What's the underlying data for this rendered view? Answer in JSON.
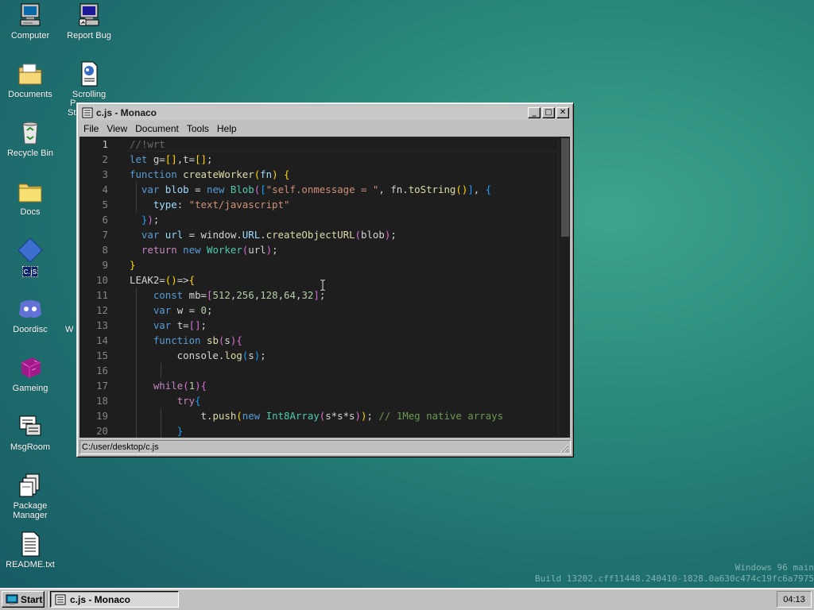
{
  "desktop": {
    "icons": [
      {
        "label": "Computer",
        "icon": "computer-icon"
      },
      {
        "label": "Report Bug",
        "icon": "report-bug-icon"
      },
      {
        "label": "Documents",
        "icon": "documents-folder-icon"
      },
      {
        "label": "Scrolling",
        "icon": "scrolling-document-icon"
      },
      {
        "label": "Recycle Bin",
        "icon": "recycle-bin-icon"
      },
      {
        "label": "Docs",
        "icon": "folder-icon"
      },
      {
        "label": "c.js",
        "icon": "diamond-file-icon"
      },
      {
        "label": "Doordisc",
        "icon": "doordisc-icon"
      },
      {
        "label": "Gameing",
        "icon": "gameing-icon"
      },
      {
        "label": "MsgRoom",
        "icon": "msgroom-icon"
      },
      {
        "label": "Package Manager",
        "icon": "package-manager-icon"
      },
      {
        "label": "README.txt",
        "icon": "text-file-icon"
      }
    ],
    "partial_labels": [
      "P",
      "St",
      "W"
    ]
  },
  "window": {
    "title": "c.js - Monaco",
    "icon": "notepad-icon",
    "buttons": {
      "minimize": "_",
      "maximize": "□",
      "close": "✕"
    },
    "menu": [
      "File",
      "View",
      "Document",
      "Tools",
      "Help"
    ],
    "status": "C:/user/desktop/c.js",
    "current_line": 1
  },
  "editor": {
    "lines": [
      {
        "n": "1",
        "tokens": [
          [
            "cmt-dim",
            "//!wrt"
          ]
        ]
      },
      {
        "n": "2",
        "tokens": [
          [
            "kw",
            "let"
          ],
          [
            "punc",
            " g="
          ],
          [
            "br1",
            "[]"
          ],
          [
            "punc",
            ",t="
          ],
          [
            "br1",
            "[]"
          ],
          [
            "punc",
            ";"
          ]
        ]
      },
      {
        "n": "3",
        "tokens": [
          [
            "kw",
            "function"
          ],
          [
            "punc",
            " "
          ],
          [
            "fn",
            "createWorker"
          ],
          [
            "br1",
            "("
          ],
          [
            "var",
            "fn"
          ],
          [
            "br1",
            ")"
          ],
          [
            "punc",
            " "
          ],
          [
            "br1",
            "{"
          ]
        ]
      },
      {
        "n": "4",
        "tokens": [
          [
            "punc",
            "  "
          ],
          [
            "kw",
            "var"
          ],
          [
            "punc",
            " "
          ],
          [
            "var",
            "blob"
          ],
          [
            "punc",
            " = "
          ],
          [
            "kw",
            "new"
          ],
          [
            "punc",
            " "
          ],
          [
            "cls",
            "Blob"
          ],
          [
            "br2",
            "("
          ],
          [
            "br3",
            "["
          ],
          [
            "str",
            "\"self.onmessage = \""
          ],
          [
            "punc",
            ", fn."
          ],
          [
            "fn",
            "toString"
          ],
          [
            "br1",
            "()"
          ],
          [
            "br3",
            "]"
          ],
          [
            "punc",
            ", "
          ],
          [
            "br3",
            "{"
          ]
        ]
      },
      {
        "n": "5",
        "tokens": [
          [
            "punc",
            "    "
          ],
          [
            "var",
            "type"
          ],
          [
            "punc",
            ": "
          ],
          [
            "str",
            "\"text/javascript\""
          ]
        ]
      },
      {
        "n": "6",
        "tokens": [
          [
            "punc",
            "  "
          ],
          [
            "br3",
            "}"
          ],
          [
            "br2",
            ")"
          ],
          [
            "punc",
            ";"
          ]
        ]
      },
      {
        "n": "7",
        "tokens": [
          [
            "punc",
            "  "
          ],
          [
            "kw",
            "var"
          ],
          [
            "punc",
            " "
          ],
          [
            "var",
            "url"
          ],
          [
            "punc",
            " = window."
          ],
          [
            "var",
            "URL"
          ],
          [
            "punc",
            "."
          ],
          [
            "fn",
            "createObjectURL"
          ],
          [
            "br2",
            "("
          ],
          [
            "punc",
            "blob"
          ],
          [
            "br2",
            ")"
          ],
          [
            "punc",
            ";"
          ]
        ]
      },
      {
        "n": "8",
        "tokens": [
          [
            "punc",
            "  "
          ],
          [
            "kw2",
            "return"
          ],
          [
            "punc",
            " "
          ],
          [
            "kw",
            "new"
          ],
          [
            "punc",
            " "
          ],
          [
            "cls",
            "Worker"
          ],
          [
            "br2",
            "("
          ],
          [
            "punc",
            "url"
          ],
          [
            "br2",
            ")"
          ],
          [
            "punc",
            ";"
          ]
        ]
      },
      {
        "n": "9",
        "tokens": [
          [
            "br1",
            "}"
          ]
        ]
      },
      {
        "n": "10",
        "tokens": [
          [
            "punc",
            "LEAK2="
          ],
          [
            "br1",
            "()"
          ],
          [
            "punc",
            "=>"
          ],
          [
            "br1",
            "{"
          ]
        ]
      },
      {
        "n": "11",
        "tokens": [
          [
            "punc",
            "    "
          ],
          [
            "kw",
            "const"
          ],
          [
            "punc",
            " mb="
          ],
          [
            "br2",
            "["
          ],
          [
            "num",
            "512"
          ],
          [
            "punc",
            ","
          ],
          [
            "num",
            "256"
          ],
          [
            "punc",
            ","
          ],
          [
            "num",
            "128"
          ],
          [
            "punc",
            ","
          ],
          [
            "num",
            "64"
          ],
          [
            "punc",
            ","
          ],
          [
            "num",
            "32"
          ],
          [
            "br2",
            "]"
          ],
          [
            "punc",
            ";"
          ]
        ]
      },
      {
        "n": "12",
        "tokens": [
          [
            "punc",
            "    "
          ],
          [
            "kw",
            "var"
          ],
          [
            "punc",
            " w = "
          ],
          [
            "num",
            "0"
          ],
          [
            "punc",
            ";"
          ]
        ]
      },
      {
        "n": "13",
        "tokens": [
          [
            "punc",
            "    "
          ],
          [
            "kw",
            "var"
          ],
          [
            "punc",
            " t="
          ],
          [
            "br2",
            "[]"
          ],
          [
            "punc",
            ";"
          ]
        ]
      },
      {
        "n": "14",
        "tokens": [
          [
            "punc",
            "    "
          ],
          [
            "kw",
            "function"
          ],
          [
            "punc",
            " "
          ],
          [
            "fn",
            "sb"
          ],
          [
            "br2",
            "("
          ],
          [
            "punc",
            "s"
          ],
          [
            "br2",
            ")"
          ],
          [
            "br2",
            "{"
          ]
        ]
      },
      {
        "n": "15",
        "tokens": [
          [
            "punc",
            "        console."
          ],
          [
            "fn",
            "log"
          ],
          [
            "br3",
            "("
          ],
          [
            "punc",
            "s"
          ],
          [
            "br3",
            ")"
          ],
          [
            "punc",
            ";"
          ]
        ]
      },
      {
        "n": "16",
        "tokens": [
          [
            "punc",
            " "
          ]
        ]
      },
      {
        "n": "17",
        "tokens": [
          [
            "punc",
            "    "
          ],
          [
            "kw2",
            "while"
          ],
          [
            "br2",
            "("
          ],
          [
            "num",
            "1"
          ],
          [
            "br2",
            ")"
          ],
          [
            "br2",
            "{"
          ]
        ]
      },
      {
        "n": "18",
        "tokens": [
          [
            "punc",
            "        "
          ],
          [
            "kw2",
            "try"
          ],
          [
            "br3",
            "{"
          ]
        ]
      },
      {
        "n": "19",
        "tokens": [
          [
            "punc",
            "            t."
          ],
          [
            "fn",
            "push"
          ],
          [
            "br1",
            "("
          ],
          [
            "kw",
            "new"
          ],
          [
            "punc",
            " "
          ],
          [
            "cls",
            "Int8Array"
          ],
          [
            "br2",
            "("
          ],
          [
            "punc",
            "s*s*s"
          ],
          [
            "br2",
            ")"
          ],
          [
            "br1",
            ")"
          ],
          [
            "punc",
            "; "
          ],
          [
            "cmt",
            "// 1Meg native arrays"
          ]
        ]
      },
      {
        "n": "20",
        "tokens": [
          [
            "punc",
            "        "
          ],
          [
            "br3",
            "}"
          ]
        ]
      }
    ]
  },
  "watermark": {
    "line1": "Windows 96 main",
    "line2": "Build 13202.cff11448.240410-1828.0a630c474c19fc6a7975"
  },
  "taskbar": {
    "start_label": "Start",
    "task_label": "c.js - Monaco",
    "clock": "04:13"
  }
}
